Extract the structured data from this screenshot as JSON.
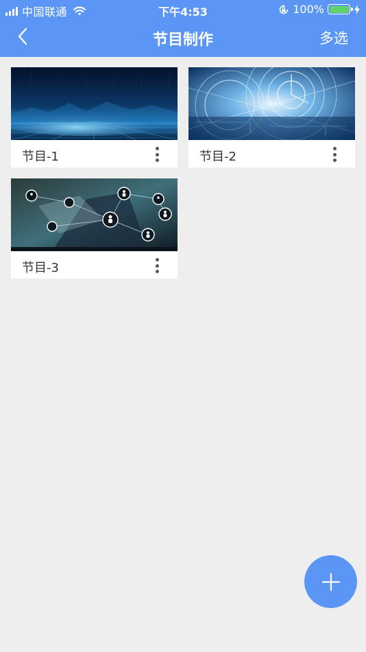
{
  "status_bar": {
    "carrier": "中国联通",
    "time": "下午4:53",
    "battery_percent": "100%",
    "icons": [
      "signal-icon",
      "wifi-icon",
      "rotation-lock-icon",
      "battery-icon",
      "charging-icon"
    ]
  },
  "nav": {
    "title": "节目制作",
    "back_icon": "chevron-left-icon",
    "right_action": "多选"
  },
  "programs": [
    {
      "label": "节目-1",
      "thumbnail": "blue-digital-landscape",
      "more_icon": "more-vertical-icon"
    },
    {
      "label": "节目-2",
      "thumbnail": "blue-tech-clock",
      "more_icon": "more-vertical-icon"
    },
    {
      "label": "节目-3",
      "thumbnail": "business-network-people",
      "more_icon": "more-vertical-icon"
    }
  ],
  "fab": {
    "icon": "plus-icon"
  },
  "colors": {
    "primary": "#5b96f5",
    "background": "#eeeeee",
    "card": "#ffffff",
    "text": "#333333"
  }
}
